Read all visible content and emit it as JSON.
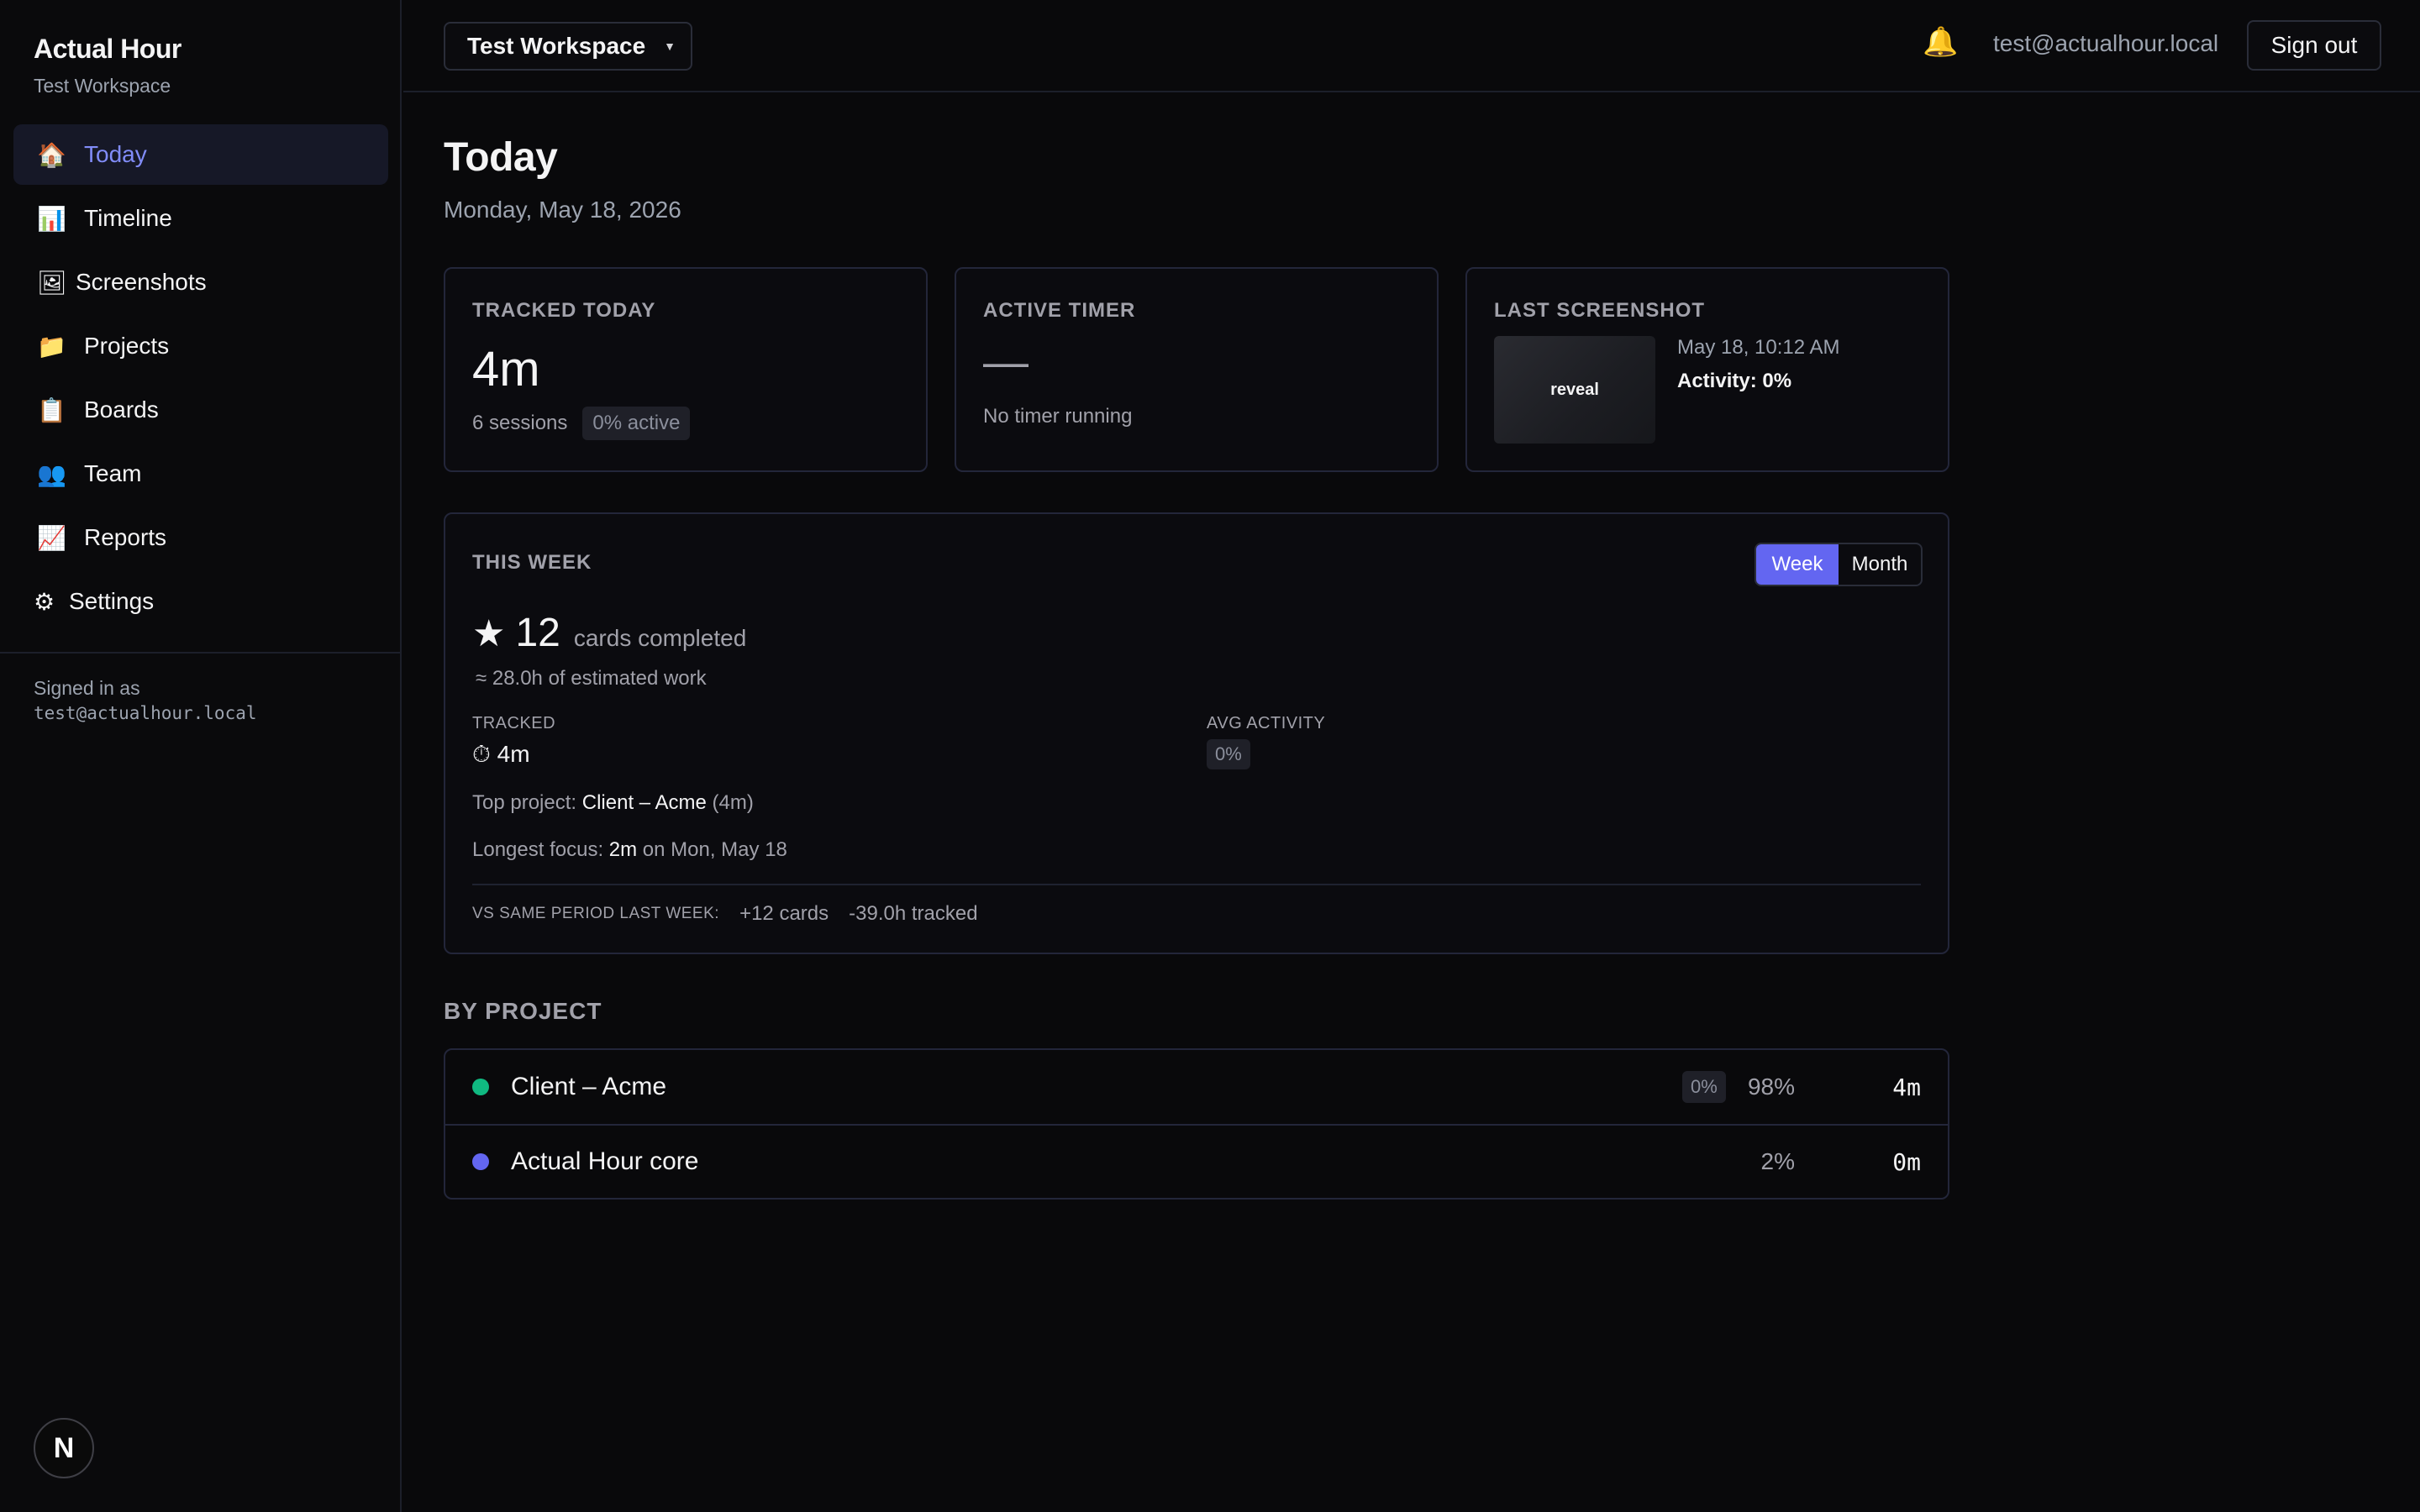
{
  "app": {
    "title": "Actual Hour",
    "workspace": "Test Workspace"
  },
  "sidebar": {
    "items": [
      {
        "label": "Today",
        "icon": "🏠"
      },
      {
        "label": "Timeline",
        "icon": "📊"
      },
      {
        "label": "Screenshots",
        "icon": "🖼"
      },
      {
        "label": "Projects",
        "icon": "📁"
      },
      {
        "label": "Boards",
        "icon": "📋"
      },
      {
        "label": "Team",
        "icon": "👥"
      },
      {
        "label": "Reports",
        "icon": "📈"
      },
      {
        "label": "Settings",
        "icon": "⚙"
      }
    ],
    "signed_in_label": "Signed in as",
    "signed_in_email": "test@actualhour.local",
    "logo_letter": "N"
  },
  "topbar": {
    "workspace_select": "Test Workspace",
    "caret": "▼",
    "bell": "🔔",
    "email": "test@actualhour.local",
    "sign_out": "Sign out"
  },
  "page": {
    "title": "Today",
    "date": "Monday, May 18, 2026"
  },
  "cards": {
    "tracked": {
      "label": "TRACKED TODAY",
      "value": "4m",
      "sessions": "6 sessions",
      "active_pill": "0% active"
    },
    "timer": {
      "label": "ACTIVE TIMER",
      "value": "—",
      "status": "No timer running"
    },
    "screenshot": {
      "label": "LAST SCREENSHOT",
      "thumb_text": "reveal",
      "time": "May 18, 10:12 AM",
      "activity": "Activity: 0%"
    }
  },
  "week": {
    "label": "THIS WEEK",
    "toggle": {
      "week": "Week",
      "month": "Month"
    },
    "star": "★",
    "cards_count": "12",
    "cards_text": "cards completed",
    "estimate": "≈ 28.0h of estimated work",
    "tracked_label": "TRACKED",
    "tracked_value": "⏱ 4m",
    "avg_label": "AVG ACTIVITY",
    "avg_value": "0%",
    "top_project_label": "Top project:",
    "top_project_name": "Client – Acme",
    "top_project_time": "(4m)",
    "longest_label": "Longest focus:",
    "longest_value": "2m",
    "longest_suffix": "on Mon, May 18",
    "vs_label": "VS SAME PERIOD LAST WEEK:",
    "vs_cards": "+12 cards",
    "vs_tracked": "-39.0h tracked"
  },
  "by_project": {
    "title": "BY PROJECT",
    "rows": [
      {
        "name": "Client – Acme",
        "color": "#10b981",
        "activity": "0%",
        "percent": "98%",
        "time": "4m"
      },
      {
        "name": "Actual Hour core",
        "color": "#6366f1",
        "percent": "2%",
        "time": "0m"
      }
    ]
  }
}
